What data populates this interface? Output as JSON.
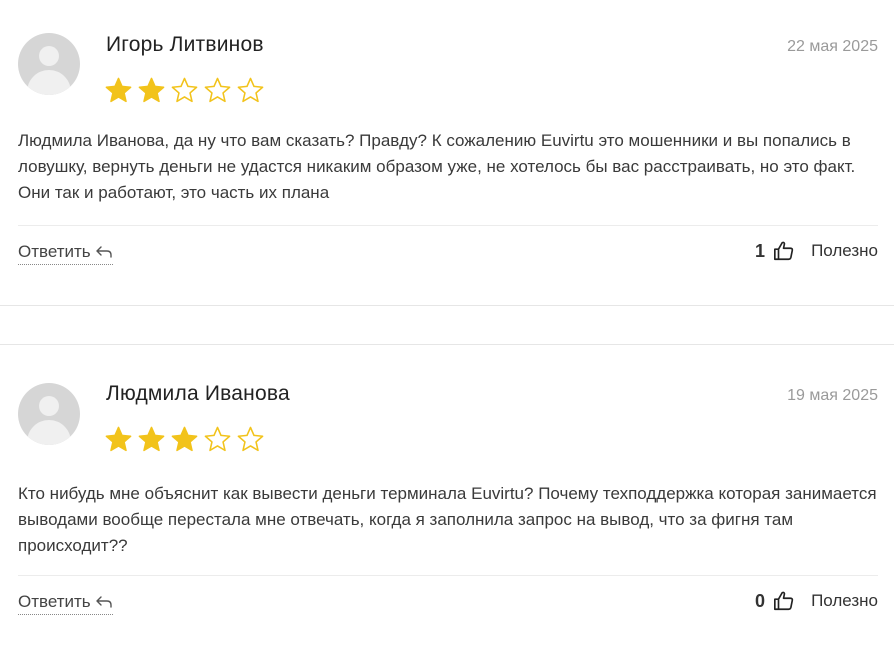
{
  "reviews": [
    {
      "author": "Игорь Литвинов",
      "date": "22 мая 2025",
      "rating": 2,
      "max_rating": 5,
      "text": "Людмила Иванова, да ну что вам сказать? Правду? К сожалению Euvirtu это мошенники и вы попались в ловушку, вернуть деньги не удастся никаким образом уже, не хотелось бы вас расстраивать, но это факт. Они так и работают, это часть их плана",
      "reply_label": "Ответить",
      "helpful_count": "1",
      "helpful_label": "Полезно"
    },
    {
      "author": "Людмила Иванова",
      "date": "19 мая 2025",
      "rating": 3,
      "max_rating": 5,
      "text": "Кто нибудь мне объяснит как вывести деньги терминала Euvirtu? Почему техподдержка которая занимается выводами вообще перестала мне отвечать, когда я заполнила запрос на вывод, что за фигня там происходит??",
      "reply_label": "Ответить",
      "helpful_count": "0",
      "helpful_label": "Полезно"
    }
  ],
  "colors": {
    "star_filled": "#F2C31B",
    "star_empty_outline": "#F2C31B",
    "avatar_bg": "#D6D6D6"
  },
  "icons": {
    "reply": "reply-arrow-icon",
    "like": "thumbs-up-icon",
    "avatar": "user-placeholder-icon"
  }
}
